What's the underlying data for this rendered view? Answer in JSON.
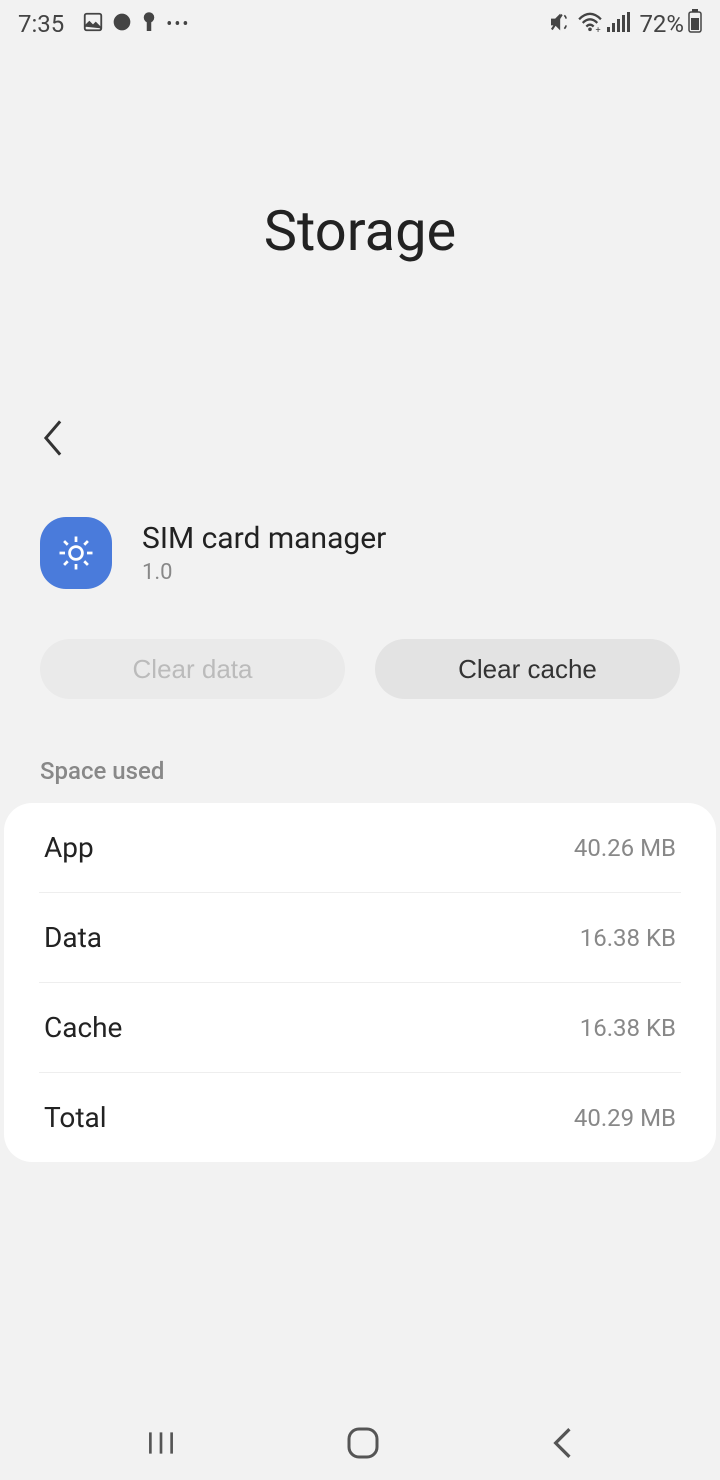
{
  "statusbar": {
    "time": "7:35",
    "battery_pct": "72%"
  },
  "page": {
    "title": "Storage"
  },
  "app": {
    "name": "SIM card manager",
    "version": "1.0"
  },
  "buttons": {
    "clear_data": "Clear data",
    "clear_cache": "Clear cache"
  },
  "section": {
    "space_used": "Space used"
  },
  "rows": [
    {
      "label": "App",
      "value": "40.26 MB"
    },
    {
      "label": "Data",
      "value": "16.38 KB"
    },
    {
      "label": "Cache",
      "value": "16.38 KB"
    },
    {
      "label": "Total",
      "value": "40.29 MB"
    }
  ]
}
